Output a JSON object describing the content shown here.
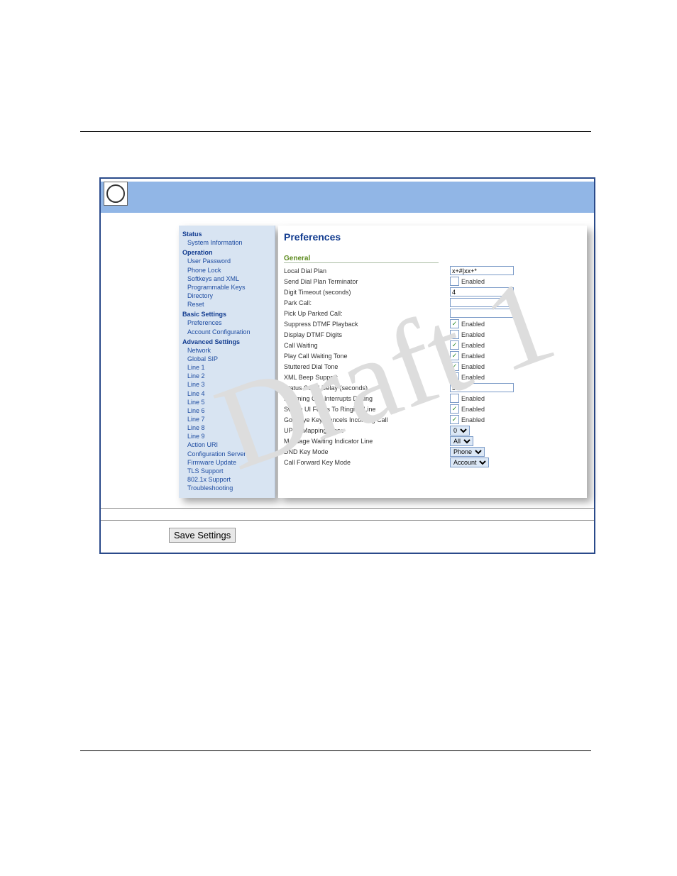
{
  "watermark": "Draft 1",
  "sidebar": {
    "status_head": "Status",
    "status_items": [
      "System Information"
    ],
    "operation_head": "Operation",
    "operation_items": [
      "User Password",
      "Phone Lock",
      "Softkeys and XML",
      "Programmable Keys",
      "Directory",
      "Reset"
    ],
    "basic_head": "Basic Settings",
    "basic_items": [
      "Preferences",
      "Account Configuration"
    ],
    "advanced_head": "Advanced Settings",
    "advanced_items": [
      "Network",
      "Global SIP",
      "Line 1",
      "Line 2",
      "Line 3",
      "Line 4",
      "Line 5",
      "Line 6",
      "Line 7",
      "Line 8",
      "Line 9",
      "Action URI",
      "Configuration Server",
      "Firmware Update",
      "TLS Support",
      "802.1x Support",
      "Troubleshooting"
    ]
  },
  "content": {
    "title": "Preferences",
    "group": "General",
    "rows": [
      {
        "label": "Local Dial Plan",
        "type": "text",
        "value": "x+#|xx+*"
      },
      {
        "label": "Send Dial Plan Terminator",
        "type": "check",
        "checked": false,
        "text": "Enabled"
      },
      {
        "label": "Digit Timeout (seconds)",
        "type": "text",
        "value": "4"
      },
      {
        "label": "Park Call:",
        "type": "text",
        "value": ""
      },
      {
        "label": "Pick Up Parked Call:",
        "type": "text",
        "value": ""
      },
      {
        "label": "Suppress DTMF Playback",
        "type": "check",
        "checked": true,
        "text": "Enabled"
      },
      {
        "label": "Display DTMF Digits",
        "type": "check",
        "checked": false,
        "text": "Enabled"
      },
      {
        "label": "Call Waiting",
        "type": "check",
        "checked": true,
        "text": "Enabled"
      },
      {
        "label": "Play Call Waiting Tone",
        "type": "check",
        "checked": true,
        "text": "Enabled"
      },
      {
        "label": "Stuttered Dial Tone",
        "type": "check",
        "checked": true,
        "text": "Enabled"
      },
      {
        "label": "XML Beep Support",
        "type": "check",
        "checked": true,
        "text": "Enabled"
      },
      {
        "label": "Status Scroll Delay (seconds)",
        "type": "text",
        "value": "5"
      },
      {
        "label": "Incoming Call Interrupts Dialing",
        "type": "check",
        "checked": false,
        "text": "Enabled"
      },
      {
        "label": "Switch UI Focus To Ringing Line",
        "type": "check",
        "checked": true,
        "text": "Enabled"
      },
      {
        "label": "Goodbye Key Cancels Incoming Call",
        "type": "check",
        "checked": true,
        "text": "Enabled"
      },
      {
        "label": "UPnP Mapping Lines",
        "type": "select",
        "value": "0"
      },
      {
        "label": "Message Waiting Indicator Line",
        "type": "select",
        "value": "All"
      },
      {
        "label": "DND Key Mode",
        "type": "select",
        "value": "Phone"
      },
      {
        "label": "Call Forward Key Mode",
        "type": "select",
        "value": "Account"
      }
    ]
  },
  "save_label": "Save Settings"
}
